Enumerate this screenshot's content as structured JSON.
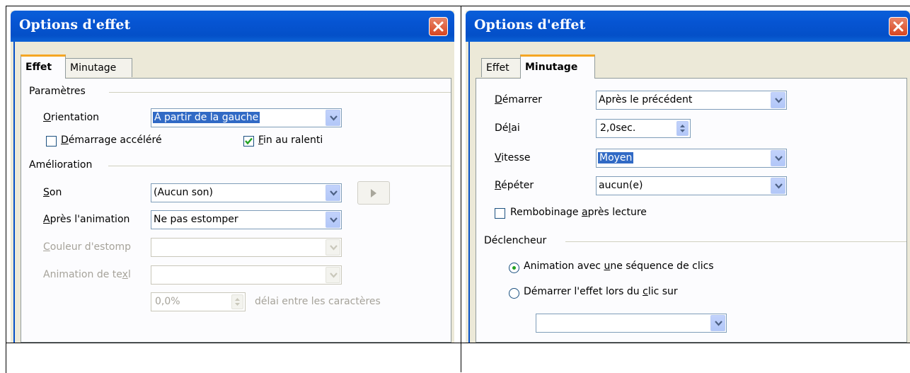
{
  "left_dialog": {
    "title": "Options d'effet",
    "tabs": [
      {
        "label": "Effet",
        "active": true
      },
      {
        "label": "Minutage",
        "active": false
      }
    ],
    "params_group": "Paramètres",
    "orientation_label": "Orientation",
    "orientation_value": "À partir de la gauche",
    "accel_start_label": "Démarrage accéléré",
    "accel_start_checked": false,
    "slow_end_label": "Fin au ralenti",
    "slow_end_checked": true,
    "enhance_group": "Amélioration",
    "sound_label": "Son",
    "sound_value": "(Aucun son)",
    "after_anim_label": "Après l'animation",
    "after_anim_value": "Ne pas estomper",
    "dim_color_label": "Couleur d'estomp",
    "dim_color_value": "",
    "text_anim_label": "Animation de texl",
    "text_anim_value": "",
    "char_delay_value": "0,0%",
    "char_delay_label": "délai entre les caractères"
  },
  "right_dialog": {
    "title": "Options d'effet",
    "tabs": [
      {
        "label": "Effet",
        "active": false
      },
      {
        "label": "Minutage",
        "active": true
      }
    ],
    "start_label": "Démarrer",
    "start_value": "Après le précédent",
    "delay_label": "Délai",
    "delay_value": "2,0sec.",
    "speed_label": "Vitesse",
    "speed_value": "Moyen",
    "repeat_label": "Répéter",
    "repeat_value": "aucun(e)",
    "rewind_label": "Rembobinage après lecture",
    "rewind_checked": false,
    "trigger_group": "Déclencheur",
    "radio_click_seq": "Animation avec une séquence de clics",
    "radio_click_seq_selected": true,
    "radio_on_click": "Démarrer l'effet lors du clic sur",
    "radio_on_click_selected": false,
    "shape_value": ""
  },
  "icons": {
    "close": "close-icon",
    "dropdown": "chevron-down-icon",
    "play": "play-icon",
    "spin": "spin-updown-icon",
    "check": "check-icon"
  },
  "colors": {
    "titlebar": "#0450c8",
    "close_button": "#d8451f",
    "dialog_bg": "#ece9d8",
    "selection": "#316ac5",
    "active_tab_accent": "#f5a623"
  }
}
